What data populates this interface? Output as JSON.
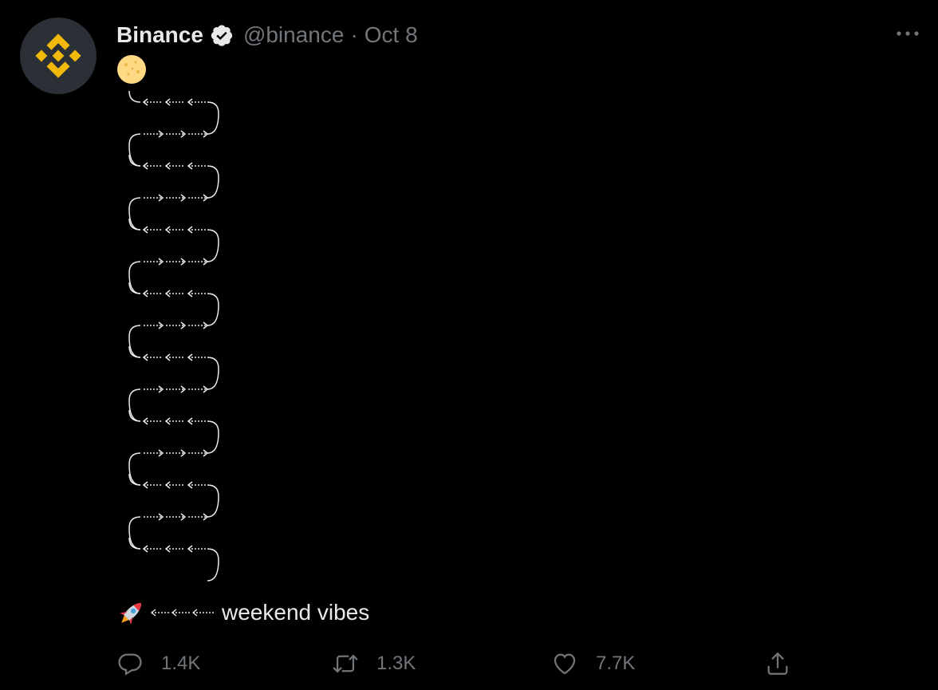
{
  "tweet": {
    "author_name": "Binance",
    "handle": "@binance",
    "separator": "·",
    "date": "Oct 8",
    "moon_emoji": "full-moon",
    "body_text": "weekend vibes",
    "rocket_emoji": "rocket",
    "art_description_rows": 15
  },
  "actions": {
    "replies": "1.4K",
    "retweets": "1.3K",
    "likes": "7.7K"
  },
  "icons": {
    "avatar": "binance-logo-icon",
    "verified": "verified-badge-icon",
    "more": "more-options-icon",
    "reply": "reply-icon",
    "retweet": "retweet-icon",
    "like": "heart-icon",
    "share": "share-icon"
  },
  "colors": {
    "background": "#000000",
    "text": "#e7e9ea",
    "muted": "#71767b",
    "brand": "#f0b90b",
    "avatar_bg": "#2b2f36"
  }
}
